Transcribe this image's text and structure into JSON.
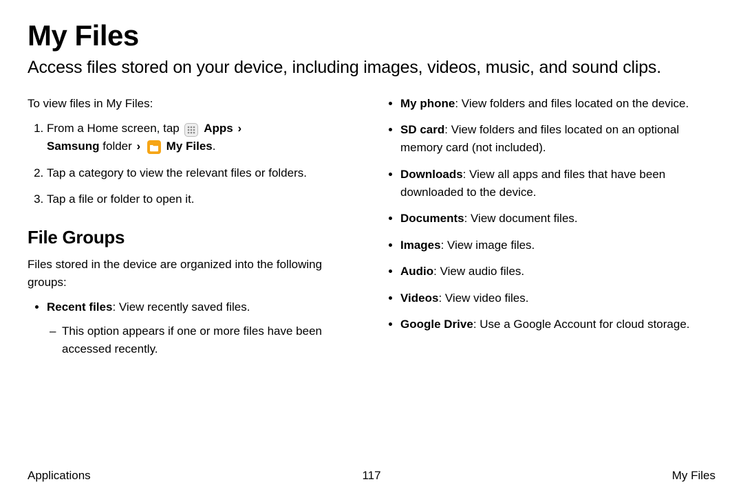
{
  "title": "My Files",
  "lead": "Access files stored on your device, including images, videos, music, and sound clips.",
  "left": {
    "intro": "To view files in My Files:",
    "step1_prefix": "From a Home screen, tap",
    "step1_apps": "Apps",
    "step1_samsung_folder": "Samsung",
    "step1_folder_word": "folder",
    "step1_myfiles": "My Files",
    "step1_period": ".",
    "step2": "Tap a category to view the relevant files or folders.",
    "step3": "Tap a file or folder to open it.",
    "section": "File Groups",
    "section_intro": "Files stored in the device are organized into the following groups:",
    "recent_label": "Recent files",
    "recent_desc": ": View recently saved files.",
    "recent_sub": "This option appears if one or more files have been accessed recently."
  },
  "right": {
    "myphone_label": "My phone",
    "myphone_desc": ": View folders and files located on the device.",
    "sdcard_label": "SD card",
    "sdcard_desc": ": View folders and files located on an optional memory card (not included).",
    "downloads_label": "Downloads",
    "downloads_desc": ": View all apps and files that have been downloaded to the device.",
    "documents_label": "Documents",
    "documents_desc": ": View document files.",
    "images_label": "Images",
    "images_desc": ": View image files.",
    "audio_label": "Audio",
    "audio_desc": ": View audio files.",
    "videos_label": "Videos",
    "videos_desc": ": View video files.",
    "gdrive_label": "Google Drive",
    "gdrive_desc": ": Use a Google Account for cloud storage."
  },
  "footer": {
    "left": "Applications",
    "center": "117",
    "right": "My Files"
  }
}
